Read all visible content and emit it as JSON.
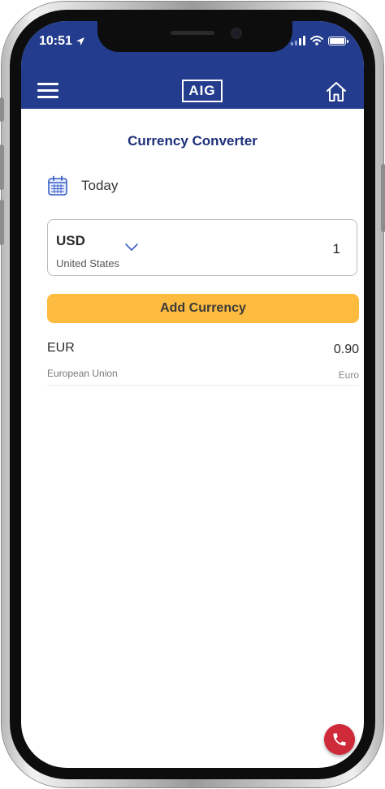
{
  "status_bar": {
    "time": "10:51"
  },
  "header": {
    "logo_text": "AIG"
  },
  "page": {
    "title": "Currency Converter"
  },
  "date_selector": {
    "label": "Today"
  },
  "base_currency": {
    "code": "USD",
    "country": "United States",
    "amount": "1"
  },
  "add_currency": {
    "label": "Add Currency"
  },
  "conversions": [
    {
      "code": "EUR",
      "country": "European Union",
      "rate": "0.90",
      "name": "Euro"
    }
  ],
  "colors": {
    "brand": "#233c8d",
    "accent": "#fdbb3f",
    "call": "#cf2a3a",
    "title": "#1d2f7a"
  },
  "icons": [
    "menu-icon",
    "home-icon",
    "calendar-icon",
    "chevron-down-icon",
    "phone-icon",
    "location-arrow-icon",
    "wifi-icon",
    "battery-icon"
  ]
}
